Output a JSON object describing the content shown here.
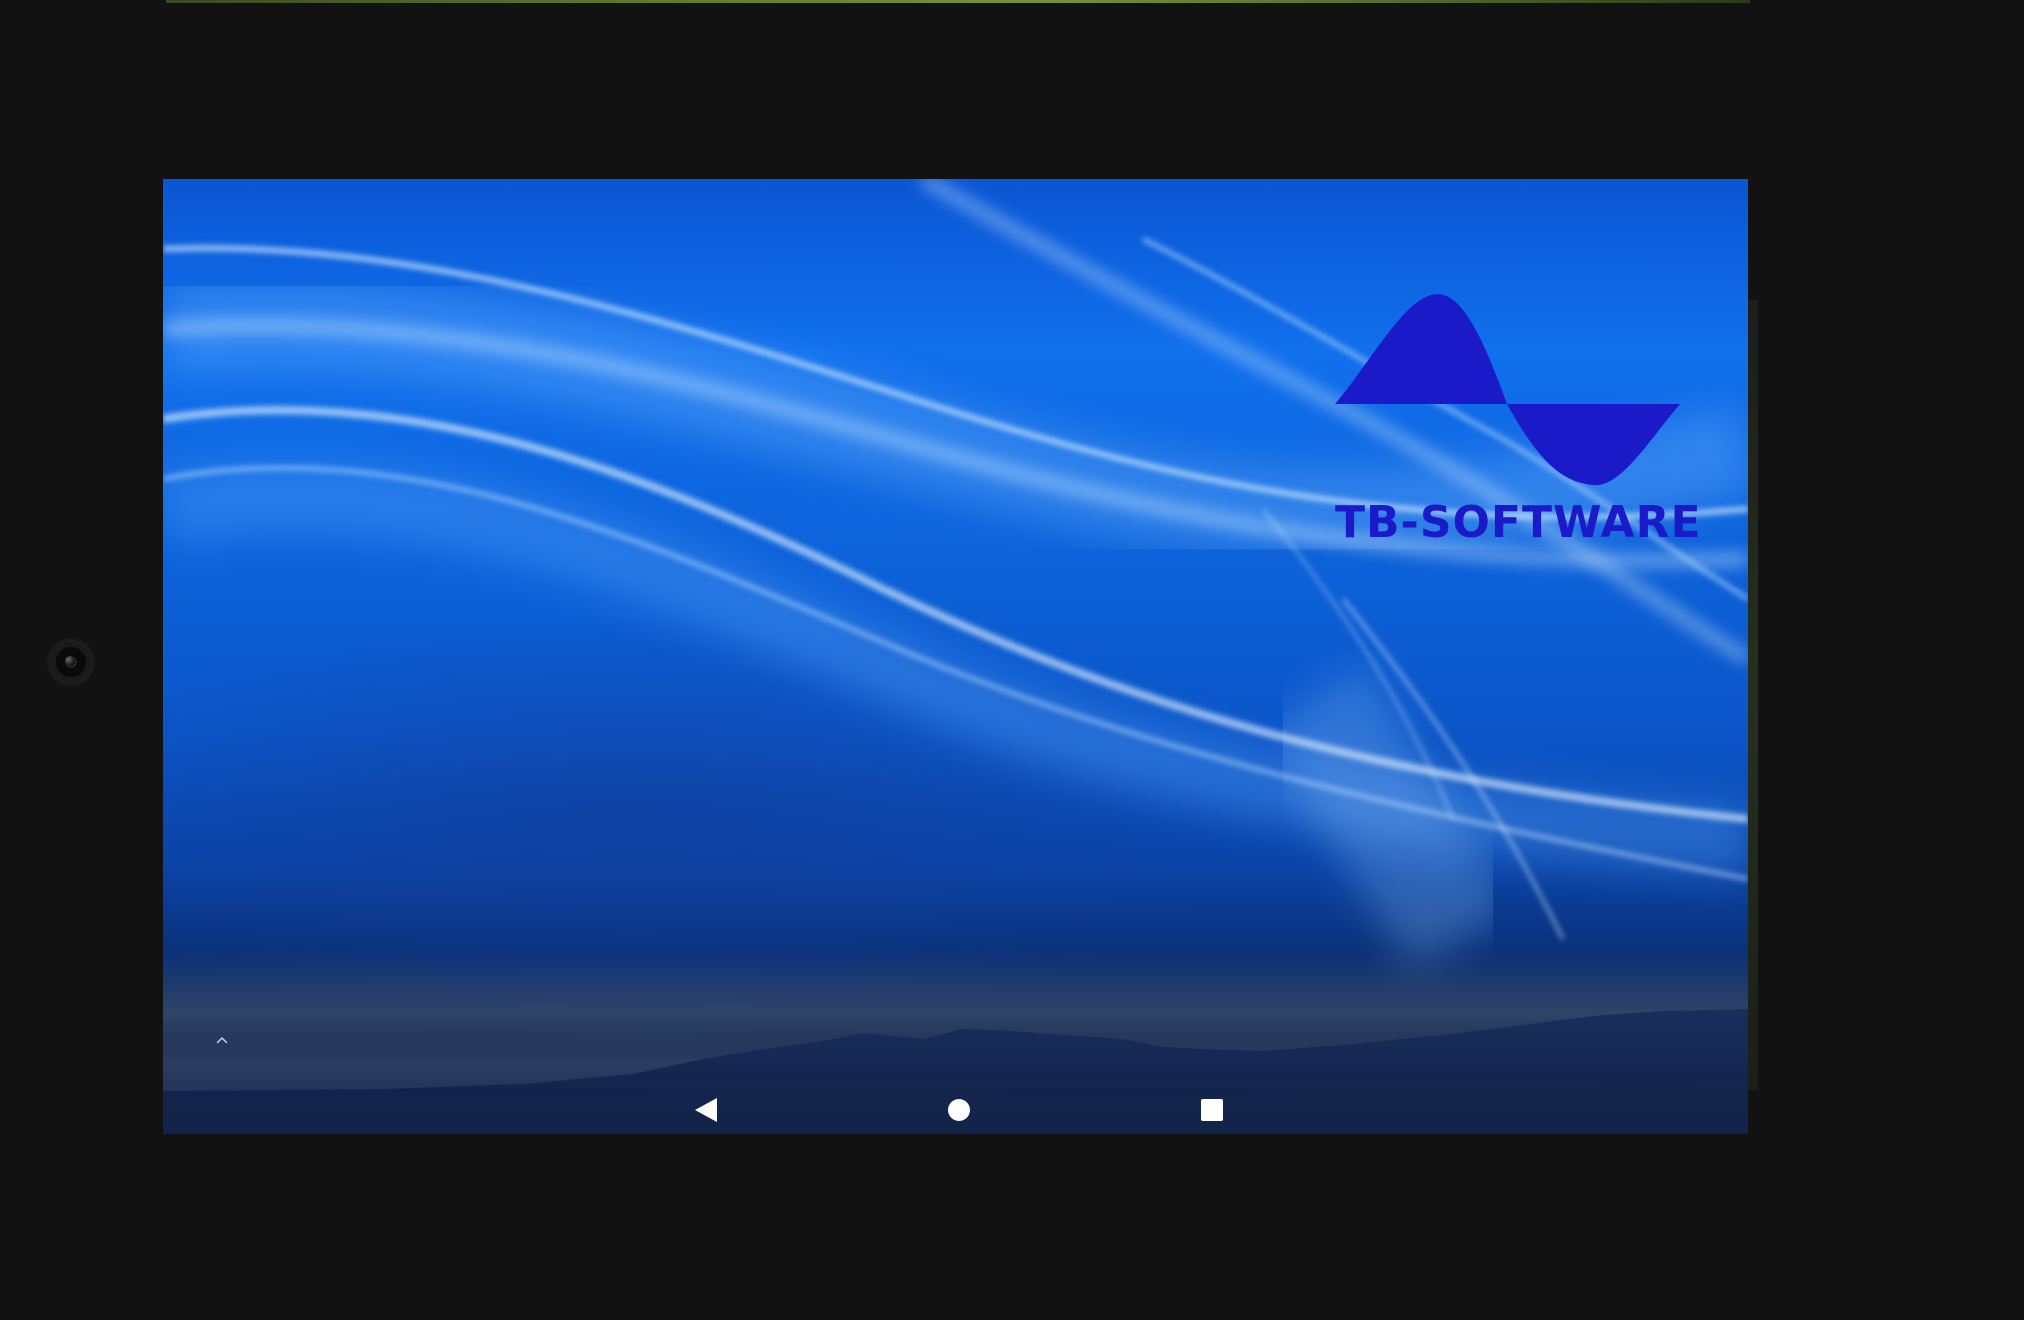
{
  "device": {
    "bezel_color": "#121212",
    "camera": "front-camera-icon"
  },
  "wallpaper": {
    "sky_color": "#0a56d4",
    "highlight_color": "#7ec3ff",
    "horizon_color": "#132a52"
  },
  "branding": {
    "logo": "sine-wave-logo-icon",
    "logo_color": "#1a1ac8",
    "company_name": "TB-SOFTWARE"
  },
  "home_screen": {
    "app_drawer_handle": "^",
    "app_drawer_icon": "chevron-up-icon"
  },
  "navigation_bar": {
    "back_icon": "back-icon",
    "home_icon": "home-icon",
    "recents_icon": "recents-icon",
    "icon_color": "#ffffff"
  }
}
